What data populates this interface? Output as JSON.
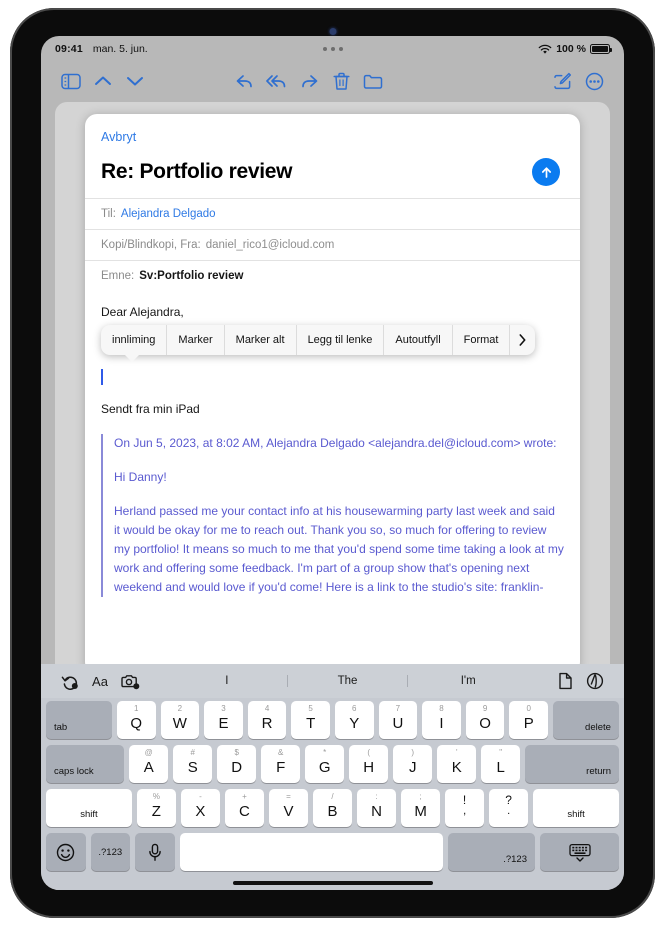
{
  "status_bar": {
    "time": "09:41",
    "date": "man. 5. jun.",
    "wifi_icon": "wifi-icon",
    "battery_percent": "100 %",
    "battery_icon": "battery-full-icon",
    "multitask_handle": "multitask-handle-icon"
  },
  "toolbar": {
    "sidebar_icon": "sidebar-icon",
    "up_icon": "chevron-up-icon",
    "down_icon": "chevron-down-icon",
    "reply_icon": "reply-icon",
    "reply_all_icon": "reply-all-icon",
    "forward_icon": "forward-icon",
    "trash_icon": "trash-icon",
    "folder_icon": "folder-icon",
    "compose_icon": "compose-icon",
    "more_icon": "more-ellipsis-icon"
  },
  "compose": {
    "cancel_label": "Avbryt",
    "title": "Re: Portfolio review",
    "send_icon": "send-arrow-up-icon",
    "fields": [
      {
        "label": "Til:",
        "value": "Alejandra Delgado",
        "style": "link"
      },
      {
        "label": "Kopi/Blindkopi, Fra:",
        "value": "daniel_rico1@icloud.com",
        "style": "grey"
      },
      {
        "label": "Emne:",
        "value": "Sv:Portfolio review",
        "style": "dark"
      }
    ],
    "greeting": "Dear Alejandra,",
    "signature": "Sendt fra min iPad"
  },
  "context_menu": {
    "items": [
      {
        "label": "innliming"
      },
      {
        "label": "Marker"
      },
      {
        "label": "Marker alt"
      },
      {
        "label": "Legg til lenke"
      },
      {
        "label": "Autoutfyll"
      },
      {
        "label": "Format"
      }
    ],
    "more_icon": "chevron-right-icon"
  },
  "quote": {
    "attribution": "On Jun 5, 2023, at 8:02 AM, Alejandra Delgado <alejandra.del@icloud.com> wrote:",
    "greeting": "Hi Danny!",
    "paragraph": "Herland passed me your contact info at his housewarming party last week and said it would be okay for me to reach out. Thank you so, so much for offering to review my portfolio! It means so much to me that you'd spend some time taking a look at my work and offering some feedback. I'm part of a group show that's opening next weekend and would love if you'd come! Here is a link to the studio's site: franklin-"
  },
  "keyboard": {
    "predictive": {
      "undo_icon": "undo-icon",
      "format_label": "Aa",
      "camera_icon": "camera-icon",
      "suggestions": [
        "I",
        "The",
        "I'm"
      ],
      "document_icon": "document-icon",
      "markup_icon": "markup-pen-icon"
    },
    "rows": [
      {
        "keys": [
          {
            "label": "tab",
            "type": "mod",
            "width": "wide15",
            "align": "bl"
          },
          {
            "label": "Q",
            "alt": "1"
          },
          {
            "label": "W",
            "alt": "2"
          },
          {
            "label": "E",
            "alt": "3"
          },
          {
            "label": "R",
            "alt": "4"
          },
          {
            "label": "T",
            "alt": "5"
          },
          {
            "label": "Y",
            "alt": "6"
          },
          {
            "label": "U",
            "alt": "7"
          },
          {
            "label": "I",
            "alt": "8"
          },
          {
            "label": "O",
            "alt": "9"
          },
          {
            "label": "P",
            "alt": "0"
          },
          {
            "label": "delete",
            "type": "mod",
            "width": "wide15",
            "align": "br"
          }
        ]
      },
      {
        "keys": [
          {
            "label": "caps lock",
            "type": "mod",
            "width": "wide18",
            "align": "bl"
          },
          {
            "label": "A",
            "alt": "@"
          },
          {
            "label": "S",
            "alt": "#"
          },
          {
            "label": "D",
            "alt": "$"
          },
          {
            "label": "F",
            "alt": "&"
          },
          {
            "label": "G",
            "alt": "*"
          },
          {
            "label": "H",
            "alt": "("
          },
          {
            "label": "J",
            "alt": ")"
          },
          {
            "label": "K",
            "alt": "'"
          },
          {
            "label": "L",
            "alt": "\""
          },
          {
            "label": "return",
            "type": "mod",
            "width": "wide22",
            "align": "br"
          }
        ]
      },
      {
        "keys": [
          {
            "label": "shift",
            "type": "white-mod",
            "width": "wide22",
            "align": "bl"
          },
          {
            "label": "Z",
            "alt": "%"
          },
          {
            "label": "X",
            "alt": "-"
          },
          {
            "label": "C",
            "alt": "+"
          },
          {
            "label": "V",
            "alt": "="
          },
          {
            "label": "B",
            "alt": "/"
          },
          {
            "label": "N",
            "alt": ":"
          },
          {
            "label": "M",
            "alt": ";"
          },
          {
            "top": "!",
            "bot": ",",
            "type": "dual"
          },
          {
            "top": "?",
            "bot": ".",
            "type": "dual"
          },
          {
            "label": "shift",
            "type": "white-mod",
            "width": "wide22",
            "align": "br"
          }
        ]
      },
      {
        "keys": [
          {
            "icon": "emoji-icon",
            "type": "mod",
            "width": "sm"
          },
          {
            "label": ".?123",
            "type": "mod",
            "width": "sm"
          },
          {
            "icon": "microphone-icon",
            "type": "mod",
            "width": "sm"
          },
          {
            "label": "",
            "type": "space"
          },
          {
            "label": ".?123",
            "type": "mod",
            "width": "wide18",
            "align": "br"
          },
          {
            "icon": "dismiss-keyboard-icon",
            "type": "mod",
            "width": "wide18"
          }
        ]
      }
    ]
  },
  "colors": {
    "accent_blue": "#2f7ae5",
    "send_blue": "#0a7bf0",
    "quote_purple": "#5a5ad0",
    "toolbar_blue": "#2f6fd0"
  }
}
